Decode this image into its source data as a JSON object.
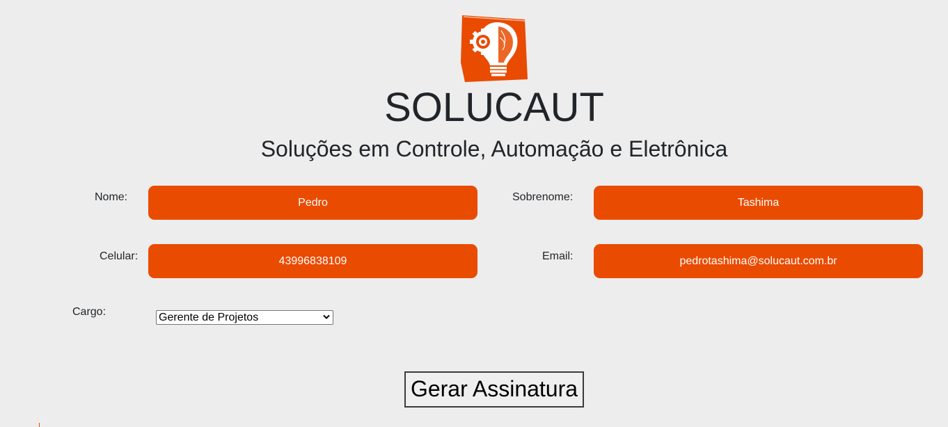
{
  "header": {
    "brand": "SOLUCAUT",
    "tagline": "Soluções em Controle, Automação e Eletrônica",
    "logo_icon": "lightbulb-gear-icon"
  },
  "form": {
    "nome": {
      "label": "Nome:",
      "value": "Pedro"
    },
    "sobrenome": {
      "label": "Sobrenome:",
      "value": "Tashima"
    },
    "celular": {
      "label": "Celular:",
      "value": "43996838109"
    },
    "email": {
      "label": "Email:",
      "value": "pedrotashima@solucaut.com.br"
    },
    "cargo": {
      "label": "Cargo:",
      "value": "Gerente de Projetos"
    },
    "submit_label": "Gerar Assinatura"
  },
  "colors": {
    "accent": "#e94b00",
    "background": "#ededed",
    "text": "#212529"
  }
}
